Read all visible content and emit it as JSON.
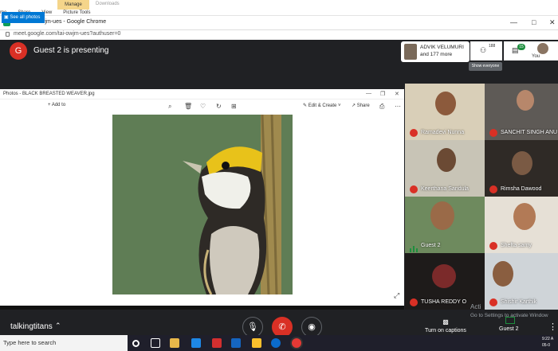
{
  "explorer": {
    "manage": "Manage",
    "downloads": "Downloads",
    "tabs": [
      "me",
      "Share",
      "View",
      "Picture Tools"
    ]
  },
  "browser": {
    "tab_title": "Meet - tai-owjm-ues - Google Chrome",
    "url": "meet.google.com/tai-owjm-ues?authuser=0"
  },
  "meet": {
    "presenter_initial": "G",
    "presenting_text": "Guest 2 is presenting",
    "participants_chip": {
      "name": "ADVIK VELUMURI",
      "more": "and 177 more"
    },
    "people_count": "188",
    "chat_badge": "15",
    "you_label": "You",
    "tooltip": "Show everyone",
    "meeting_name": "talkingtitans",
    "captions_label": "Turn on captions",
    "presenting_tile_label": "Guest 2",
    "activate_line1": "Acti",
    "activate_line2": "Go to Settings to activate Window"
  },
  "photos": {
    "title": "Photos - BLACK BREASTED WEAVER.jpg",
    "see_all": "See all photos",
    "add_to": "Add to",
    "edit_create": "Edit & Create",
    "share": "Share"
  },
  "tiles": [
    {
      "name": "Ramadevi Nunna",
      "muted": true
    },
    {
      "name": "SANCHIT SINGH ANU",
      "muted": true
    },
    {
      "name": "Keerthana Sandula",
      "muted": true
    },
    {
      "name": "Rimsha Dawood",
      "muted": true
    },
    {
      "name": "Guest 2",
      "muted": false
    },
    {
      "name": "Shefta samy",
      "muted": true
    },
    {
      "name": "TUSHA REDDY O",
      "muted": true
    },
    {
      "name": "Shishir Karthik",
      "muted": true
    }
  ],
  "taskbar": {
    "search": "Type here to search",
    "time": "9:22 A",
    "date": "05-0"
  }
}
